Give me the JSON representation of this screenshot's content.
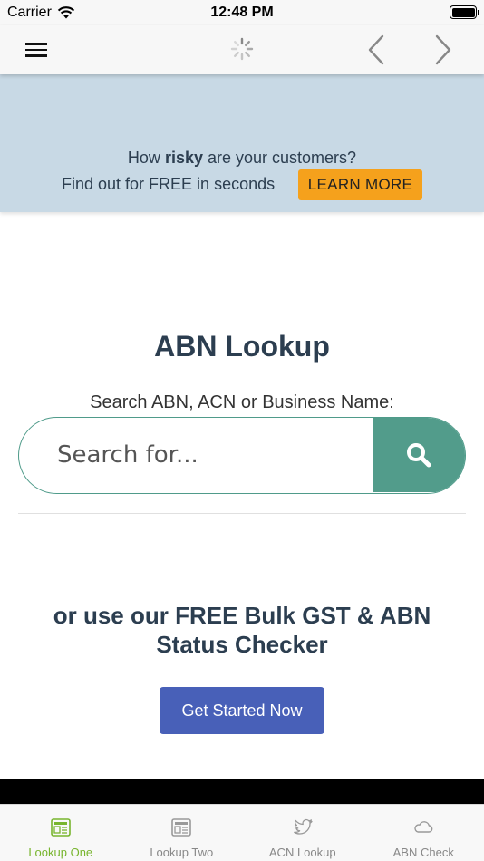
{
  "status_bar": {
    "carrier": "Carrier",
    "time": "12:48 PM"
  },
  "nav": {
    "menu_icon": "hamburger-menu-icon",
    "loading_icon": "activity-spinner-icon",
    "back_icon": "chevron-left-icon",
    "forward_icon": "chevron-right-icon"
  },
  "banner": {
    "line1_prefix": "How ",
    "line1_bold": "risky",
    "line1_suffix": " are your customers?",
    "line2": "Find out for FREE in seconds",
    "cta_label": "LEARN MORE",
    "background_color": "#c8d9e5",
    "cta_color": "#f5a11c"
  },
  "main": {
    "title": "ABN Lookup",
    "search_caption": "Search ABN, ACN or Business Name:",
    "search_placeholder": "Search for...",
    "search_value": "",
    "search_button_icon": "search-icon",
    "accent_color": "#529c8b",
    "bulk_heading": "or use our FREE Bulk GST & ABN Status Checker",
    "start_button_label": "Get Started Now",
    "start_button_color": "#4860b8"
  },
  "tab_bar": {
    "active_color": "#78b52e",
    "tabs": [
      {
        "label": "Lookup One",
        "icon": "newspaper-icon",
        "active": true
      },
      {
        "label": "Lookup Two",
        "icon": "newspaper-icon",
        "active": false
      },
      {
        "label": "ACN Lookup",
        "icon": "twitter-bird-icon",
        "active": false
      },
      {
        "label": "ABN Check",
        "icon": "cloud-icon",
        "active": false
      }
    ]
  }
}
